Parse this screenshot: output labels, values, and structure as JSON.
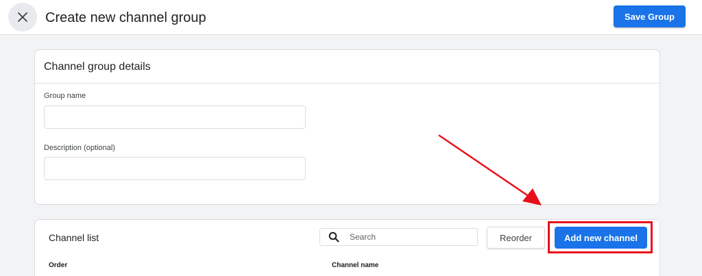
{
  "header": {
    "title": "Create new channel group",
    "close_icon": "close-icon",
    "save_label": "Save Group"
  },
  "details": {
    "title": "Channel group details",
    "group_name_label": "Group name",
    "group_name_value": "",
    "description_label": "Description (optional)",
    "description_value": ""
  },
  "channel_list": {
    "title": "Channel list",
    "search_icon": "search-icon",
    "search_placeholder": "Search",
    "reorder_label": "Reorder",
    "add_label": "Add new channel",
    "columns": [
      "Order",
      "Channel name"
    ]
  },
  "annotation": {
    "color": "#e8101a"
  },
  "colors": {
    "accent": "#1a73e8",
    "background": "#f1f3f4"
  }
}
